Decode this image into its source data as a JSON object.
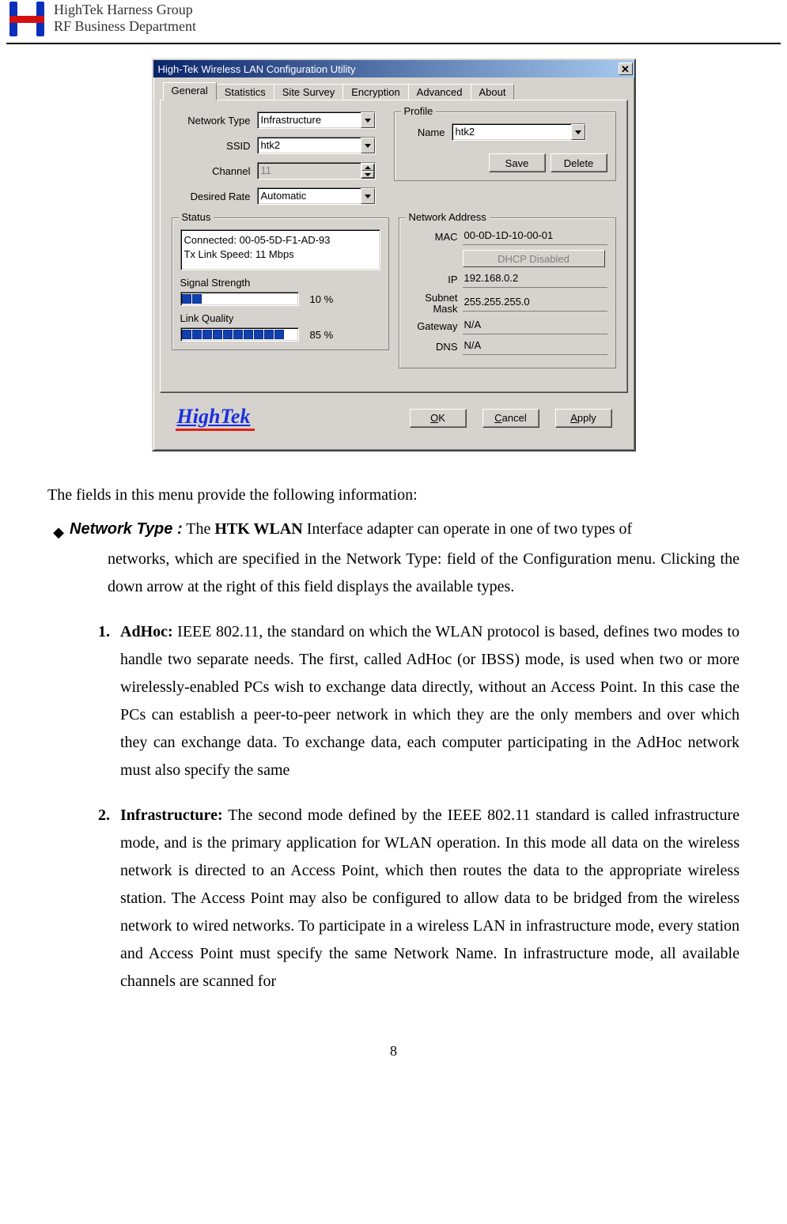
{
  "header": {
    "line1": "HighTek Harness Group",
    "line2": "RF Business Department"
  },
  "dialog": {
    "title": "High-Tek Wireless LAN Configuration Utility",
    "tabs": [
      "General",
      "Statistics",
      "Site Survey",
      "Encryption",
      "Advanced",
      "About"
    ],
    "fields": {
      "network_type_label": "Network Type",
      "network_type_value": "Infrastructure",
      "ssid_label": "SSID",
      "ssid_value": "htk2",
      "channel_label": "Channel",
      "channel_value": "11",
      "desired_rate_label": "Desired Rate",
      "desired_rate_value": "Automatic"
    },
    "profile": {
      "legend": "Profile",
      "name_label": "Name",
      "name_value": "htk2",
      "save": "Save",
      "delete": "Delete"
    },
    "status": {
      "legend": "Status",
      "line1": "Connected: 00-05-5D-F1-AD-93",
      "line2": "Tx Link Speed: 11 Mbps",
      "signal_label": "Signal Strength",
      "signal_pct": "10  %",
      "link_label": "Link Quality",
      "link_pct": "85  %"
    },
    "netaddr": {
      "legend": "Network Address",
      "mac_label": "MAC",
      "mac": "00-0D-1D-10-00-01",
      "dhcp": "DHCP Disabled",
      "ip_label": "IP",
      "ip": "192.168.0.2",
      "subnet_label": "Subnet Mask",
      "subnet": "255.255.255.0",
      "gateway_label": "Gateway",
      "gateway": "N/A",
      "dns_label": "DNS",
      "dns": "N/A"
    },
    "brand": "HighTek",
    "buttons": {
      "ok": "OK",
      "cancel": "Cancel",
      "apply": "Apply"
    }
  },
  "doc": {
    "intro": "The fields in this menu provide the following information:",
    "nt_title": "Network Type :",
    "nt_body_first": "The HTK WLAN Interface adapter can operate in one of two types of",
    "nt_body_rest": "networks, which are specified in the Network Type: field of the Configuration menu. Clicking the down arrow at the right of this field displays the available types.",
    "items": [
      {
        "num": "1.",
        "lead": "AdHoc:",
        "text": " IEEE 802.11, the standard on which the WLAN protocol is based, defines two modes to handle two separate needs. The first, called AdHoc (or IBSS) mode, is used when two or more wirelessly-enabled PCs wish to exchange data directly, without an Access Point. In this case the PCs can establish a peer-to-peer network in which they are the only members and over which they can exchange data. To exchange data, each computer participating in the AdHoc network must also specify the same"
      },
      {
        "num": "2.",
        "lead": "Infrastructure:",
        "text": " The second mode defined by the IEEE 802.11 standard is called infrastructure mode, and is the primary application for WLAN operation. In this mode all data on the wireless network is directed to an Access Point, which then routes the data to the appropriate wireless station. The Access Point may also be configured to allow data to be bridged from the wireless network to wired networks. To participate in a wireless LAN in infrastructure mode, every station and Access Point must specify the same Network Name. In infrastructure mode, all available channels are scanned for"
      }
    ],
    "page_no": "8"
  }
}
